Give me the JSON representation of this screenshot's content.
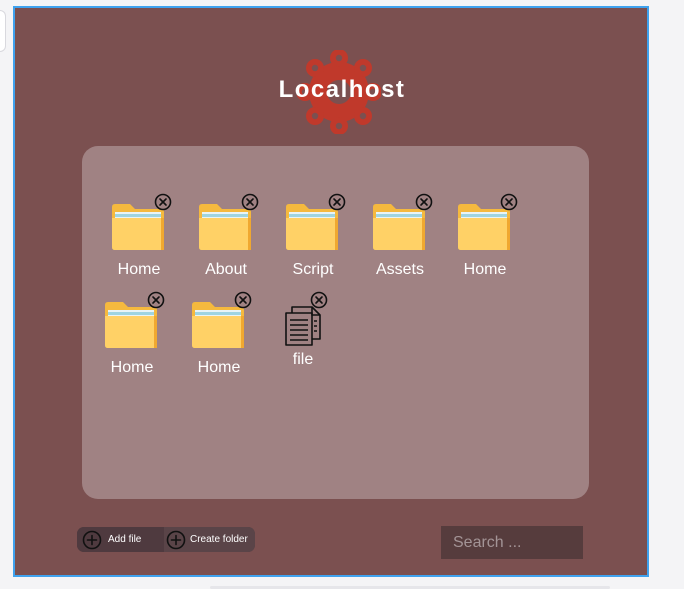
{
  "app": {
    "brand_name": "Localhost",
    "brand_color": "#c0392b",
    "background_color": "#7b5050",
    "panel_color": "#a08283"
  },
  "items": [
    {
      "type": "folder",
      "label": "Home",
      "icon": "folder-icon"
    },
    {
      "type": "folder",
      "label": "About",
      "icon": "folder-icon"
    },
    {
      "type": "folder",
      "label": "Script",
      "icon": "folder-icon"
    },
    {
      "type": "folder",
      "label": "Assets",
      "icon": "folder-icon"
    },
    {
      "type": "folder",
      "label": "Home",
      "icon": "folder-icon"
    },
    {
      "type": "folder",
      "label": "Home",
      "icon": "folder-icon"
    },
    {
      "type": "folder",
      "label": "Home",
      "icon": "folder-icon"
    },
    {
      "type": "file",
      "label": "file",
      "icon": "document-icon"
    }
  ],
  "toolbar": {
    "add_file_label": "Add file",
    "create_folder_label": "Create folder"
  },
  "search": {
    "placeholder": "Search ..."
  }
}
